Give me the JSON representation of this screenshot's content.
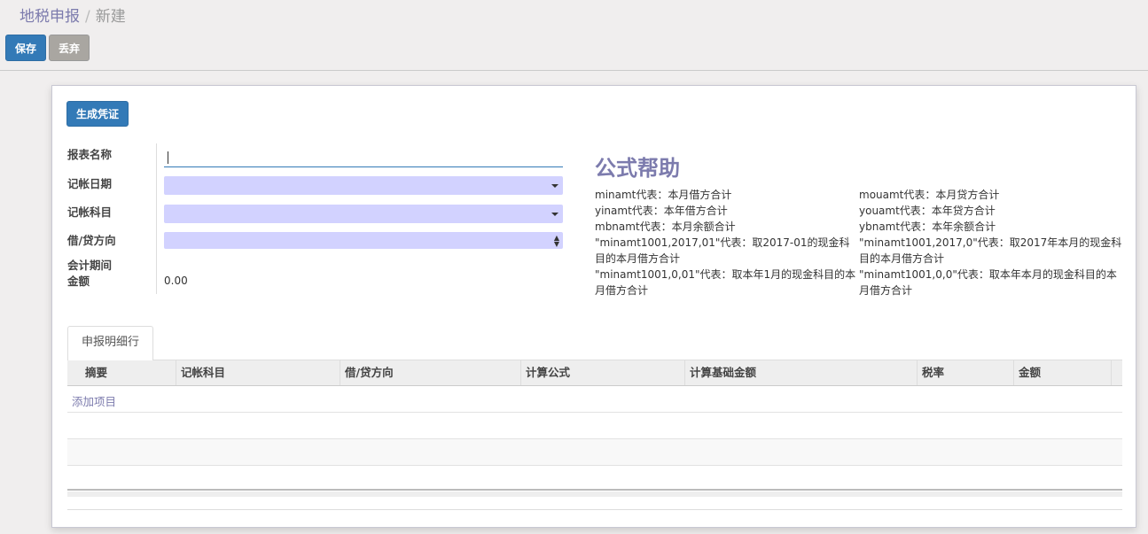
{
  "breadcrumb": {
    "root": "地税申报",
    "separator": "/",
    "current": "新建"
  },
  "toolbar": {
    "save_label": "保存",
    "discard_label": "丢弃"
  },
  "sheet": {
    "generate_voucher_label": "生成凭证",
    "fields": {
      "report_name_label": "报表名称",
      "report_name_value": "",
      "posting_date_label": "记帐日期",
      "posting_account_label": "记帐科目",
      "direction_label": "借/贷方向",
      "period_amount_label_1": "会计期间",
      "period_amount_label_2": "金额",
      "period_amount_value": "0.00"
    },
    "help": {
      "title": "公式帮助",
      "left": [
        "minamt代表：本月借方合计",
        "yinamt代表：本年借方合计",
        "mbnamt代表：本月余额合计",
        "\"minamt1001,2017,01\"代表：取2017-01的现金科目的本月借方合计",
        "\"minamt1001,0,01\"代表：取本年1月的现金科目的本月借方合计"
      ],
      "right": [
        "mouamt代表：本月贷方合计",
        "youamt代表：本年贷方合计",
        "ybnamt代表：本年余额合计",
        "\"minamt1001,2017,0\"代表：取2017年本月的现金科目的本月借方合计",
        "\"minamt1001,0,0\"代表：取本年本月的现金科目的本月借方合计"
      ]
    },
    "tab_label": "申报明细行",
    "table": {
      "headers": [
        "摘要",
        "记帐科目",
        "借/贷方向",
        "计算公式",
        "计算基础金额",
        "税率",
        "金额"
      ],
      "add_item_label": "添加项目"
    }
  }
}
